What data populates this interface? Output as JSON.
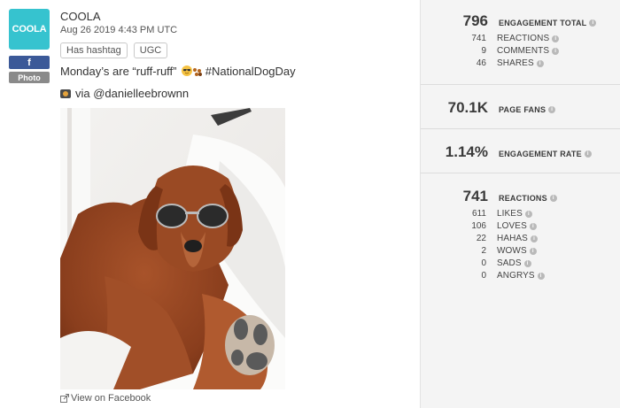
{
  "post": {
    "page_name": "COOLA",
    "avatar_text": "COOLA",
    "network_badge": "f",
    "type_badge": "Photo",
    "timestamp": "Aug 26 2019 4:43 PM UTC",
    "tags": [
      "Has hashtag",
      "UGC"
    ],
    "caption_text": "Monday’s are “ruff-ruff”",
    "caption_hashtag": "#NationalDogDay",
    "via_text": "via @danielleebrownn",
    "view_link": "View on Facebook"
  },
  "stats": {
    "engagement": {
      "total": "796",
      "total_label": "ENGAGEMENT TOTAL",
      "rows": [
        {
          "value": "741",
          "label": "REACTIONS"
        },
        {
          "value": "9",
          "label": "COMMENTS"
        },
        {
          "value": "46",
          "label": "SHARES"
        }
      ]
    },
    "page_fans": {
      "value": "70.1K",
      "label": "PAGE FANS"
    },
    "engagement_rate": {
      "value": "1.14%",
      "label": "ENGAGEMENT RATE"
    },
    "reactions": {
      "total": "741",
      "total_label": "REACTIONS",
      "rows": [
        {
          "value": "611",
          "label": "LIKES"
        },
        {
          "value": "106",
          "label": "LOVES"
        },
        {
          "value": "22",
          "label": "HAHAS"
        },
        {
          "value": "2",
          "label": "WOWS"
        },
        {
          "value": "0",
          "label": "SADS"
        },
        {
          "value": "0",
          "label": "ANGRYS"
        }
      ]
    }
  },
  "colors": {
    "avatar_bg": "#36c3cf",
    "facebook": "#3b5998",
    "panel_bg": "#f4f4f4"
  },
  "icons": [
    "info-icon",
    "external-link-icon",
    "camera-icon"
  ]
}
